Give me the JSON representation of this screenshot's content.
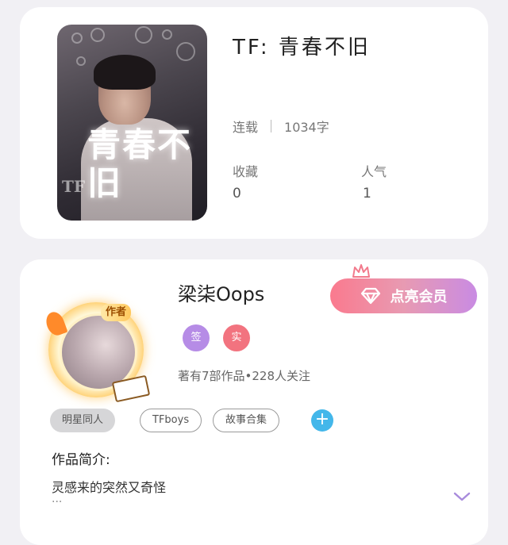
{
  "book": {
    "title": "TF: 青春不旧",
    "cover_title": "青春不旧",
    "cover_mark": "TF",
    "status": "连载",
    "word_count": "1034字",
    "stats": [
      {
        "label": "收藏",
        "value": "0"
      },
      {
        "label": "人气",
        "value": "1"
      }
    ]
  },
  "author": {
    "name": "梁柒Oops",
    "avatar_badge": "作者",
    "badges": [
      {
        "text": "签",
        "color": "#b68ce6"
      },
      {
        "text": "实",
        "color": "#f2737f"
      }
    ],
    "works_info": "著有7部作品•228人关注",
    "vip_button_label": "点亮会员",
    "vip_icon": "diamond-icon",
    "crown_icon": "crown-icon"
  },
  "tags": [
    {
      "label": "明星同人",
      "style": "filled"
    },
    {
      "label": "TFboys",
      "style": "outline"
    },
    {
      "label": "故事合集",
      "style": "outline"
    }
  ],
  "add_tag_label": "+",
  "intro": {
    "title": "作品简介:",
    "text": "灵感来的突然又奇怪",
    "ellipsis": "...",
    "expand_icon": "chevron-down-icon"
  },
  "colors": {
    "accent_pink": "#fa7a8e",
    "accent_purple": "#c98be3",
    "add_blue": "#43b7ea",
    "background": "#f1f0f4"
  }
}
